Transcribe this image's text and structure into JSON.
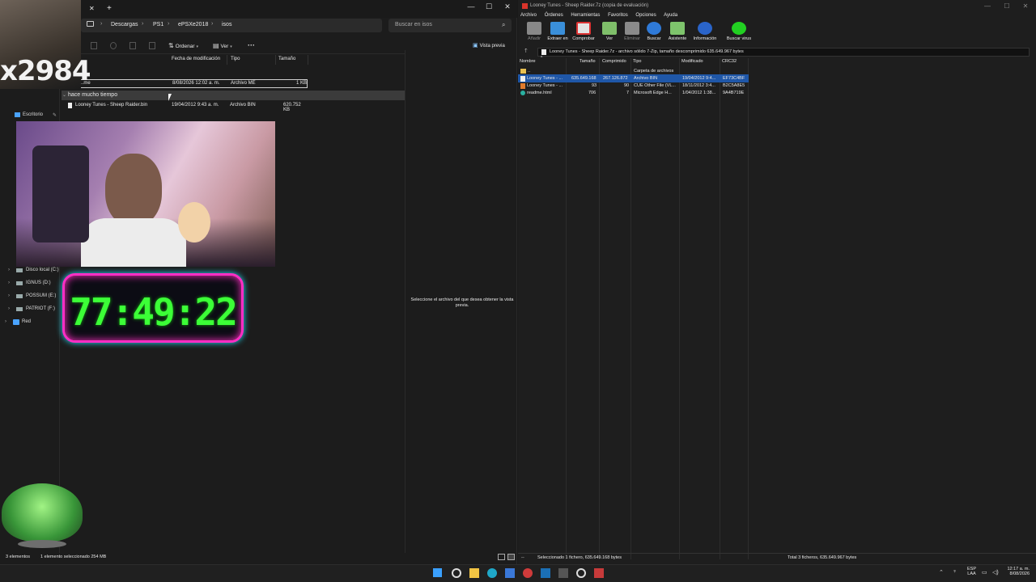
{
  "explorer": {
    "tab_close": "✕",
    "tab_new": "+",
    "window_controls": [
      "—",
      "☐",
      "✕"
    ],
    "breadcrumb": [
      "Descargas",
      "PS1",
      "ePSXe2018",
      "isos"
    ],
    "search_placeholder": "Buscar en isos",
    "toolbar": {
      "sort": "Ordenar",
      "view": "Ver",
      "more": "···",
      "preview": "Vista previa"
    },
    "columns": {
      "date": "Fecha de modificación",
      "type": "Tipo",
      "size": "Tamaño"
    },
    "files": [
      {
        "name": "ex...me",
        "date": "8/08/2026 12:02 a. m.",
        "type": "Archivo ME",
        "size": "1 KB"
      },
      {
        "name": "Looney Tunes - Sheep Raider.bin",
        "date": "19/04/2012 9:43 a. m.",
        "type": "Archivo BIN",
        "size": "620.752 KB"
      }
    ],
    "group_header": "hace mucho tiempo",
    "sidebar": {
      "user": "Estiven - Persona",
      "pinned": "Escritorio",
      "drives": [
        "Disco local (C:)",
        "IGNUS (D:)",
        "POSSUM (E:)",
        "PATRIOT (F:)",
        "Red"
      ]
    },
    "preview_message": "Seleccione el archivo del que desea obtener la vista previa.",
    "status": {
      "count": "3 elementos",
      "selected": "1 elemento seleccionado  254 MB"
    }
  },
  "overlay": {
    "timer": "77:49:22",
    "stream_tag": "x2984"
  },
  "z7": {
    "title": "Looney Tunes - Sheep Raider.7z (copia de evaluación)",
    "menu": [
      "Archivo",
      "Órdenes",
      "Herramientas",
      "Favoritos",
      "Opciones",
      "Ayuda"
    ],
    "toolbar": [
      "Añadir",
      "Extraer en",
      "Comprobar",
      "Ver",
      "Eliminar",
      "Buscar",
      "Asistente",
      "Información",
      "Buscar virus"
    ],
    "path": "Looney Tunes - Sheep Raider.7z - archivo sólido 7-Zip, tamaño descomprimido 635.649.967 bytes",
    "columns": [
      "Nombre",
      "Tamaño",
      "Comprimido",
      "Tipo",
      "Modificado",
      "CRC32"
    ],
    "rows": [
      {
        "name": "..",
        "size": "",
        "packed": "",
        "type": "Carpeta de archivos",
        "modified": "",
        "crc": ""
      },
      {
        "name": "Looney Tunes - ...",
        "size": "635.649.168",
        "packed": "267.126.872",
        "type": "Archivo BIN",
        "modified": "19/04/2012 9:4...",
        "crc": "EF73C4BF"
      },
      {
        "name": "Looney Tunes - ...",
        "size": "93",
        "packed": "90",
        "type": "CUE Other File (VL...",
        "modified": "18/11/2012 3:4...",
        "crc": "B2C5A8E5"
      },
      {
        "name": "readme.html",
        "size": "706",
        "packed": "7",
        "type": "Microsoft Edge H...",
        "modified": "1/04/2012 1:38...",
        "crc": "9A4B719E"
      }
    ],
    "status_left": "Seleccionado 1 fichero, 635.649.168 bytes",
    "status_right": "Total 3 ficheros, 635.649.967 bytes"
  },
  "tray": {
    "lang": "ESP",
    "lang2": "LAA",
    "time": "12:17 a. m.",
    "date": "8/08/2026"
  }
}
